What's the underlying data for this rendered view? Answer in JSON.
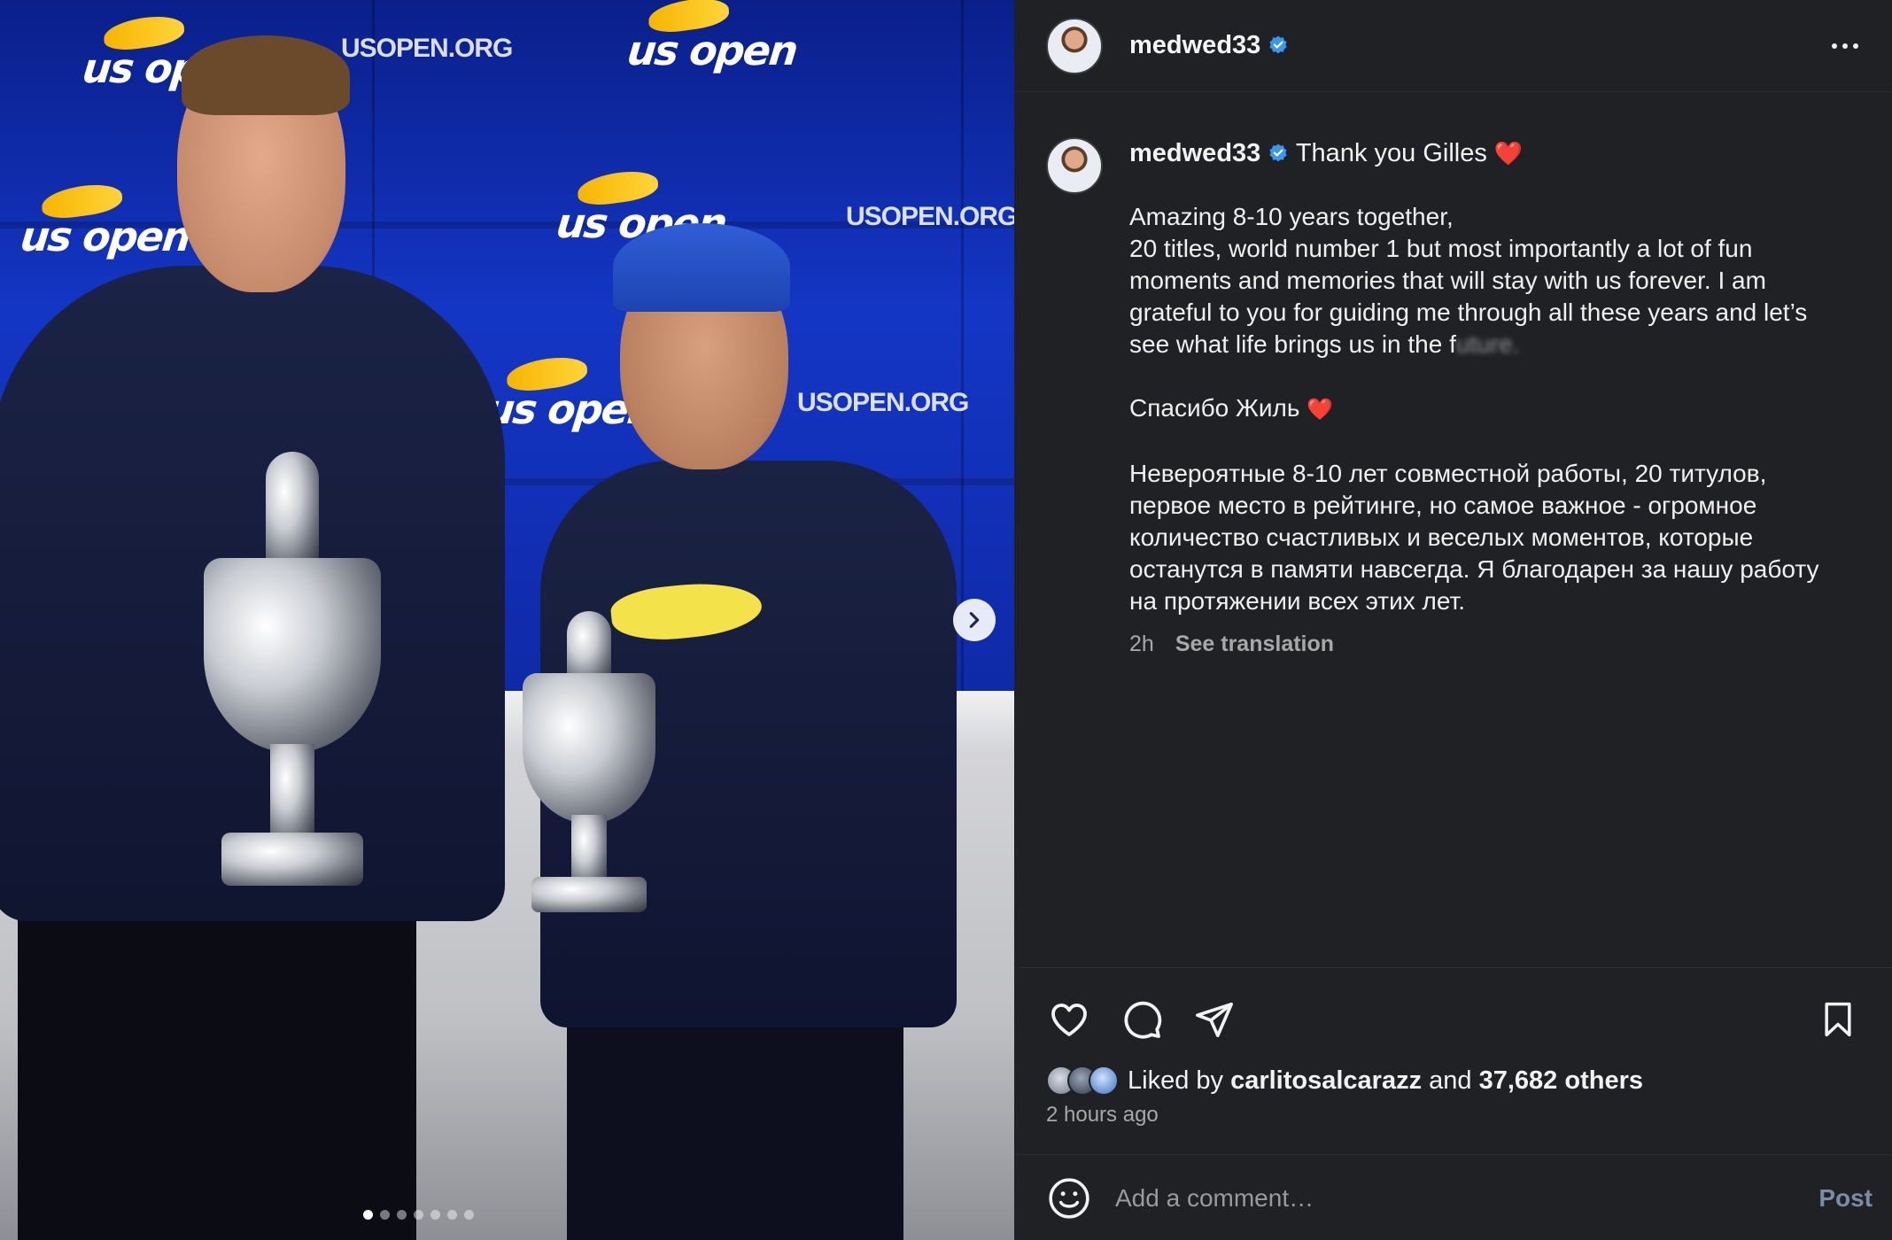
{
  "media": {
    "logo_text": "us open",
    "site_text": "USOPEN.ORG",
    "carousel_total": 7,
    "carousel_active": 1,
    "next_icon": "chevron-right-icon"
  },
  "header": {
    "username": "medwed33",
    "verified_icon": "verified-badge-icon",
    "more_icon": "more-horizontal-icon"
  },
  "caption": {
    "username": "medwed33",
    "first_line": "Thank you Gilles",
    "heart": "❤️",
    "para1": [
      "Amazing 8-10 years together,",
      "20 titles, world number 1 but most importantly a lot of fun",
      "moments and memories that will stay with us forever. I am",
      "grateful to you for guiding me through all these years and let’s",
      "see what life brings us in the f"
    ],
    "para1_tail": "uture.",
    "para2": "Спасибо Жиль",
    "para3": [
      "Невероятные 8-10 лет совместной работы, 20 титулов,",
      "первое место в рейтинге, но самое важное - огромное",
      "количество счастливых и веселых моментов, которые",
      "останутся в памяти навсегда. Я благодарен за нашу работу",
      "на протяжении всех этих лет."
    ],
    "time": "2h",
    "see_translation": "See translation"
  },
  "actions": {
    "like_icon": "heart-icon",
    "comment_icon": "comment-icon",
    "share_icon": "share-icon",
    "save_icon": "bookmark-icon",
    "liked_by_prefix": "Liked by",
    "liked_by_user": "carlitosalcarazz",
    "liked_by_and": "and",
    "others": "37,682 others",
    "time_ago": "2 hours ago"
  },
  "comment": {
    "emoji_icon": "emoji-icon",
    "placeholder": "Add a comment…",
    "post_label": "Post"
  },
  "colors": {
    "panel_bg": "#202125",
    "heart": "#ff3040",
    "verified": "#3897f0",
    "muted": "#a8a8a8"
  }
}
